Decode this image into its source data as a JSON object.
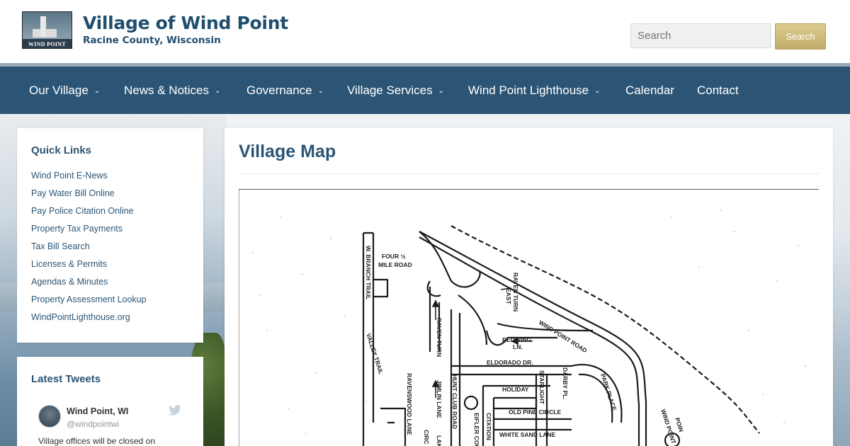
{
  "header": {
    "logo_text": "WIND POINT",
    "title": "Village of Wind Point",
    "subtitle": "Racine County, Wisconsin",
    "search_placeholder": "Search",
    "search_button": "Search"
  },
  "nav": {
    "items": [
      {
        "label": "Our Village",
        "has_dropdown": true
      },
      {
        "label": "News & Notices",
        "has_dropdown": true
      },
      {
        "label": "Governance",
        "has_dropdown": true
      },
      {
        "label": "Village Services",
        "has_dropdown": true
      },
      {
        "label": "Wind Point Lighthouse",
        "has_dropdown": true
      },
      {
        "label": "Calendar",
        "has_dropdown": false
      },
      {
        "label": "Contact",
        "has_dropdown": false
      }
    ]
  },
  "sidebar": {
    "quick_links_title": "Quick Links",
    "quick_links": [
      "Wind Point E-News",
      "Pay Water Bill Online",
      "Pay Police Citation Online",
      "Property Tax Payments",
      "Tax Bill Search",
      "Licenses & Permits",
      "Agendas & Minutes",
      "Property Assessment Lookup",
      "WindPointLighthouse.org"
    ],
    "tweets_title": "Latest Tweets",
    "tweet": {
      "name": "Wind Point, WI",
      "handle": "@windpointwi",
      "text": "Village offices will be closed on"
    }
  },
  "main": {
    "page_title": "Village Map",
    "map_labels": {
      "four_half_mile_1": "FOUR ½",
      "four_half_mile_2": "MILE ROAD",
      "w_branch_trail": "W. BRANCH TRAIL",
      "valley_trail": "VALLEY TRAIL",
      "raven_turn_east_1": "RAVEN TURN",
      "raven_turn_east_2": "EAST",
      "raven_turn": "RAVEN TURN",
      "wind_point_road": "WIND POINT ROAD",
      "redwing_1": "REDWING",
      "redwing_2": "LN.",
      "eldorado": "ELDORADO DR.",
      "hunt_club_road": "HUNT CLUB ROAD",
      "ravenswood_lane": "RAVENSWOOD LANE",
      "jimlin_lane": "JIMLIN LANE",
      "holiday": "HOLIDAY",
      "starlight": "STARLIGHT",
      "darby_pl": "DARBY PL.",
      "old_pine_circle": "OLD PINE CIRCLE",
      "park_place": "PARK PLACE",
      "eifler_court": "EIFLER COURT",
      "citation": "CITATION",
      "white_sand_lane": "WHITE SAND LANE",
      "wind_point_dr": "WIND POINT DR.",
      "lak": "LAK",
      "circ": "CIRC",
      "point": "POIN"
    }
  },
  "colors": {
    "brand_blue": "#2c5575",
    "title_blue": "#1f4e6e",
    "search_gold": "#c9b574"
  }
}
